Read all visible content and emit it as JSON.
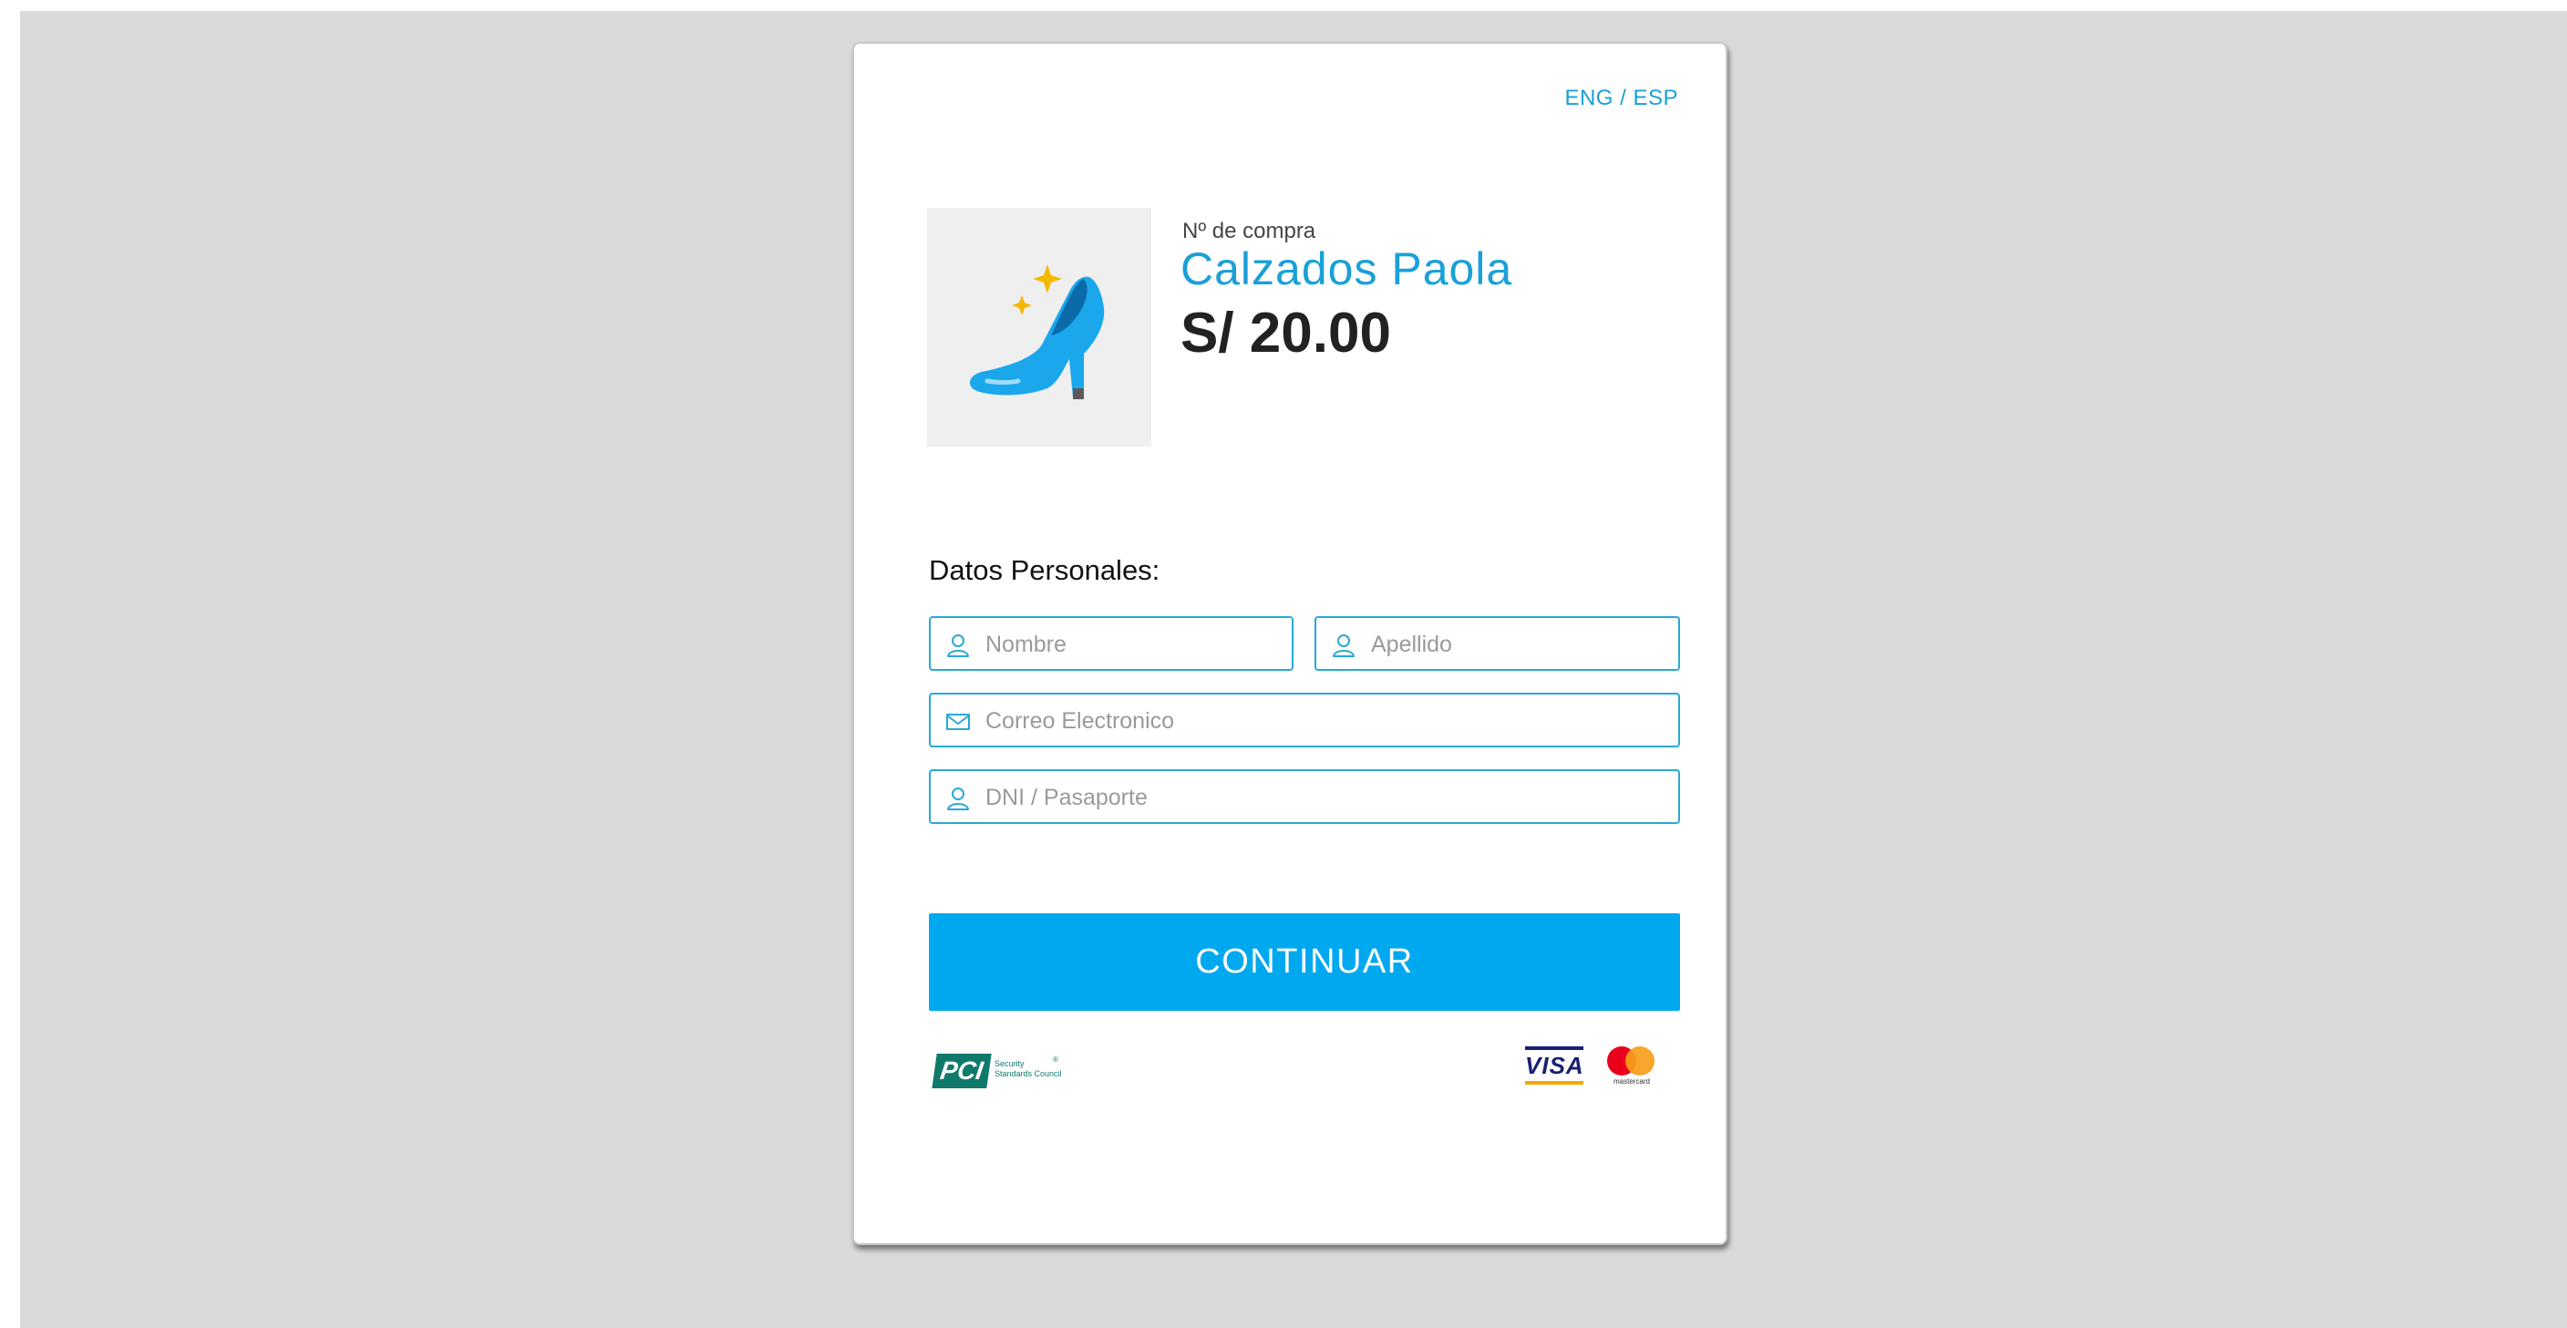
{
  "lang_switch": "ENG / ESP",
  "product": {
    "image_icon": "high-heel-shoe-icon",
    "order_label": "Nº de compra",
    "store_name": "Calzados Paola",
    "amount": "S/ 20.00"
  },
  "form": {
    "section_title": "Datos Personales:",
    "nombre": {
      "placeholder": "Nombre",
      "value": "",
      "icon": "user-icon"
    },
    "apellido": {
      "placeholder": "Apellido",
      "value": "",
      "icon": "user-icon"
    },
    "correo": {
      "placeholder": "Correo Electronico",
      "value": "",
      "icon": "envelope-icon"
    },
    "dni": {
      "placeholder": "DNI / Pasaporte",
      "value": "",
      "icon": "user-icon"
    },
    "submit_label": "CONTINUAR"
  },
  "footer": {
    "pci_logo_text": "PCI",
    "pci_caption_line1": "Security",
    "pci_caption_line2": "Standards Council",
    "visa_text": "VISA",
    "mastercard_text": "mastercard"
  },
  "colors": {
    "accent": "#00a8f0",
    "link": "#1aa0d8",
    "backdrop": "#dadada"
  }
}
